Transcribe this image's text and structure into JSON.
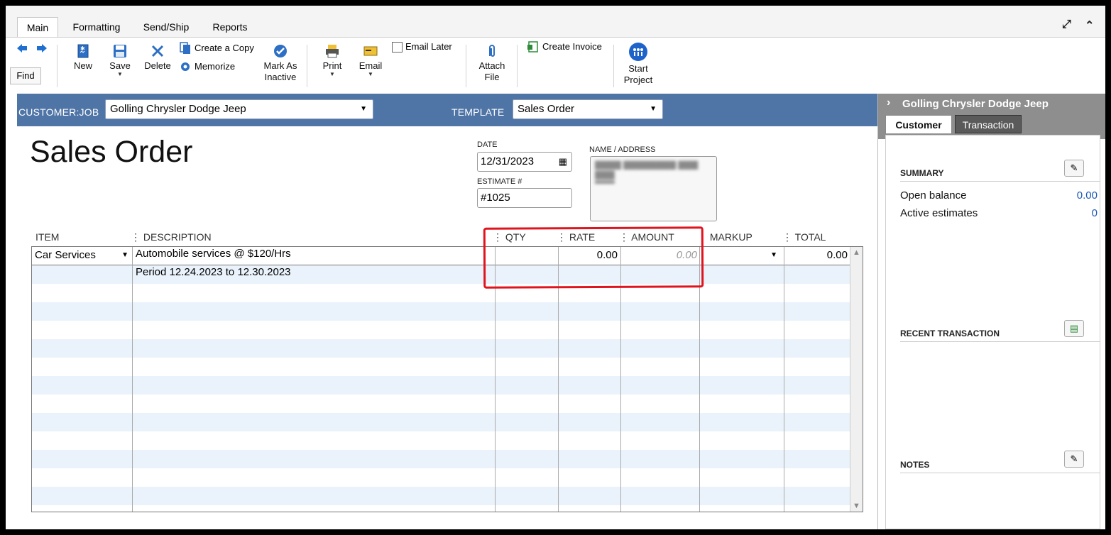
{
  "tabs": [
    "Main",
    "Formatting",
    "Send/Ship",
    "Reports"
  ],
  "toolbar": {
    "find": "Find",
    "new": "New",
    "save": "Save",
    "delete": "Delete",
    "create_copy": "Create a Copy",
    "memorize": "Memorize",
    "mark_as": "Mark As",
    "inactive": "Inactive",
    "print": "Print",
    "email": "Email",
    "email_later": "Email Later",
    "attach": "Attach",
    "file": "File",
    "create_invoice": "Create Invoice",
    "start": "Start",
    "project": "Project"
  },
  "header": {
    "customer_label": "CUSTOMER:JOB",
    "customer_value": "Golling Chrysler Dodge Jeep",
    "template_label": "TEMPLATE",
    "template_value": "Sales Order"
  },
  "form": {
    "title": "Sales Order",
    "date_label": "DATE",
    "date_value": "12/31/2023",
    "estimate_label": "ESTIMATE #",
    "estimate_value": "#1025",
    "name_address_label": "NAME / ADDRESS"
  },
  "table": {
    "columns": [
      "ITEM",
      "DESCRIPTION",
      "QTY",
      "RATE",
      "AMOUNT",
      "MARKUP",
      "TOTAL"
    ],
    "rows": [
      {
        "item": "Car Services",
        "description": "Automobile services @ $120/Hrs",
        "qty": "",
        "rate": "0.00",
        "amount": "0.00",
        "markup": "",
        "total": "0.00"
      },
      {
        "item": "",
        "description": "Period 12.24.2023 to 12.30.2023",
        "qty": "",
        "rate": "",
        "amount": "",
        "markup": "",
        "total": ""
      }
    ]
  },
  "panel": {
    "title": "Golling Chrysler Dodge Jeep",
    "tab_customer": "Customer",
    "tab_transaction": "Transaction",
    "summary_label": "SUMMARY",
    "open_balance_label": "Open balance",
    "open_balance_value": "0.00",
    "active_estimates_label": "Active estimates",
    "active_estimates_value": "0",
    "recent_label": "RECENT TRANSACTION",
    "notes_label": "NOTES"
  },
  "colors": {
    "header_bar": "#4f74a6",
    "highlight": "#e0141e",
    "link_value": "#1b57b4"
  }
}
